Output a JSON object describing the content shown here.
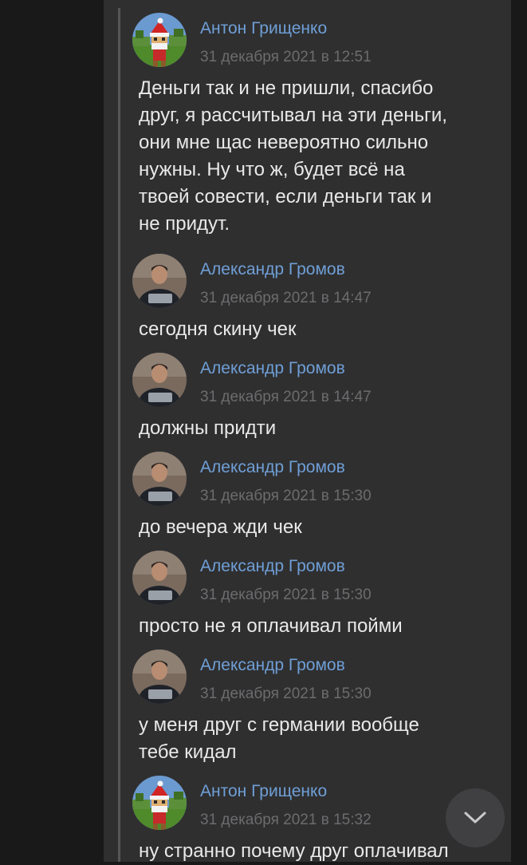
{
  "messages": [
    {
      "author": "Антон Грищенко",
      "date": "31 декабря 2021 в 12:51",
      "text": "Деньги так и не пришли, спасибо\nдруг, я рассчитывал на эти деньги,\nони мне щас невероятно сильно\nнужны. Ну что ж, будет всё на\nтвоей совести, если деньги так и\nне придут."
    },
    {
      "author": "Александр Громов",
      "date": "31 декабря 2021 в 14:47",
      "text": "сегодня скину чек"
    },
    {
      "author": "Александр Громов",
      "date": "31 декабря 2021 в 14:47",
      "text": "должны придти"
    },
    {
      "author": "Александр Громов",
      "date": "31 декабря 2021 в 15:30",
      "text": "до вечера жди чек"
    },
    {
      "author": "Александр Громов",
      "date": "31 декабря 2021 в 15:30",
      "text": "просто не я оплачивал пойми"
    },
    {
      "author": "Александр Громов",
      "date": "31 декабря 2021 в 15:30",
      "text": "у меня друг с германии вообще\nтебе кидал"
    },
    {
      "author": "Антон Грищенко",
      "date": "31 декабря 2021 в 15:32",
      "text": "ну странно почему друг оплачивал"
    }
  ],
  "icons": {
    "avatar_anton": "minecraft-santa-avatar",
    "avatar_alexander": "person-with-laptop-avatar",
    "scroll_down": "chevron-down-icon"
  },
  "colors": {
    "author_name": "#6f9fd6",
    "date": "#6c6c6e",
    "message_text": "#e9e9ea",
    "panel_background": "#2f2f30"
  }
}
